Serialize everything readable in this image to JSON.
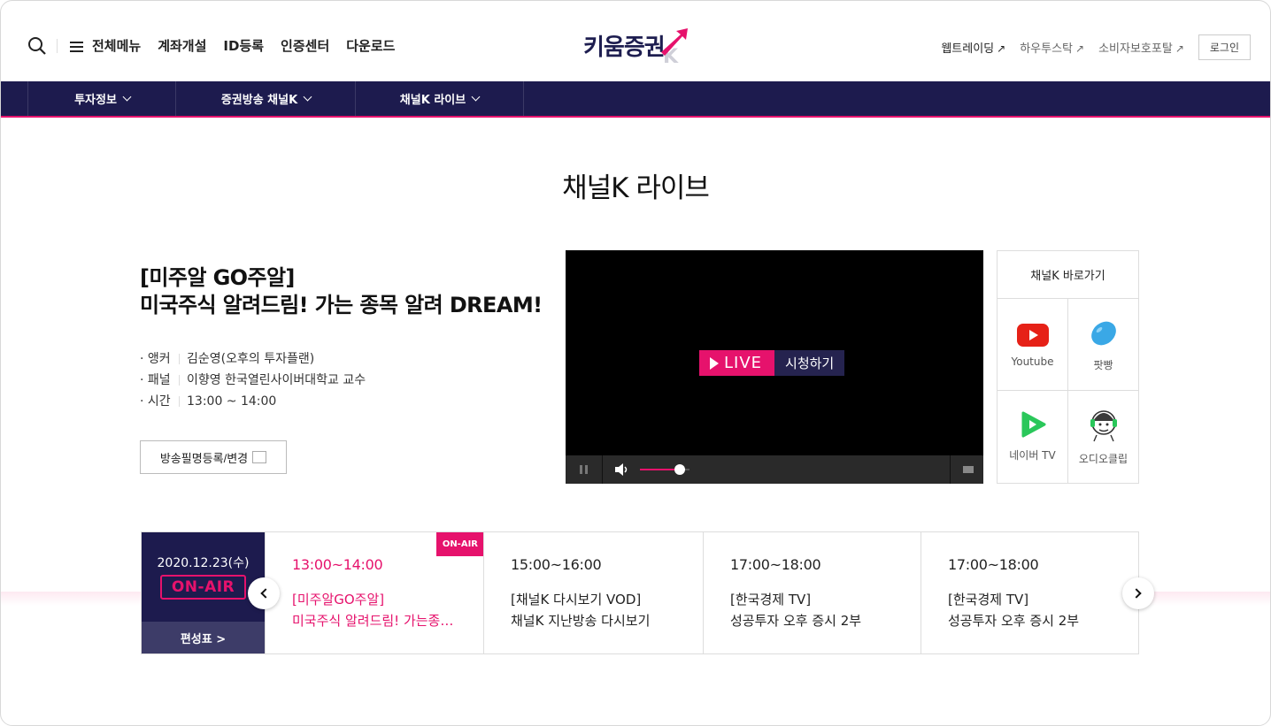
{
  "header": {
    "menu_label": "전체메뉴",
    "gnb": [
      "계좌개설",
      "ID등록",
      "인증센터",
      "다운로드"
    ],
    "logo_text": "키움증권",
    "util_links": [
      "웹트레이딩",
      "하우투스탁",
      "소비자보호포탈"
    ],
    "login_label": "로그인"
  },
  "nav": {
    "tabs": [
      "투자정보",
      "증권방송 채널K",
      "채널K 라이브"
    ]
  },
  "page_title": "채널K 라이브",
  "program": {
    "title_line1": "[미주알 GO주알]",
    "title_line2": "미국주식 알려드림! 가는 종목 알려 DREAM!",
    "details": [
      {
        "key": "· 앵커",
        "value": "김순영(오후의 투자플랜)"
      },
      {
        "key": "· 패널",
        "value": "이향영 한국열린사이버대학교 교수"
      },
      {
        "key": "· 시간",
        "value": "13:00 ~ 14:00"
      }
    ],
    "register_button": "방송필명등록/변경"
  },
  "player": {
    "live_label": "LIVE",
    "watch_label": "시청하기",
    "volume": 0.8
  },
  "channels": {
    "heading": "채널K 바로가기",
    "items": [
      "Youtube",
      "팟빵",
      "네이버 TV",
      "오디오클립"
    ]
  },
  "schedule": {
    "date": "2020.12.23(수)",
    "onair_label": "ON-AIR",
    "table_link": "편성표 >",
    "onair_tag": "ON-AIR",
    "slots": [
      {
        "time": "13:00~14:00",
        "line1": "[미주알GO주알]",
        "line2": "미국주식 알려드림! 가는종목...",
        "active": true
      },
      {
        "time": "15:00~16:00",
        "line1": "[채널K 다시보기 VOD]",
        "line2": "채널K 지난방송 다시보기",
        "active": false
      },
      {
        "time": "17:00~18:00",
        "line1": "[한국경제 TV]",
        "line2": "성공투자 오후 증시 2부",
        "active": false
      },
      {
        "time": "17:00~18:00",
        "line1": "[한국경제 TV]",
        "line2": "성공투자 오후 증시 2부",
        "active": false
      }
    ]
  },
  "colors": {
    "navy": "#1d1b4e",
    "accent_pink": "#e6126c"
  }
}
